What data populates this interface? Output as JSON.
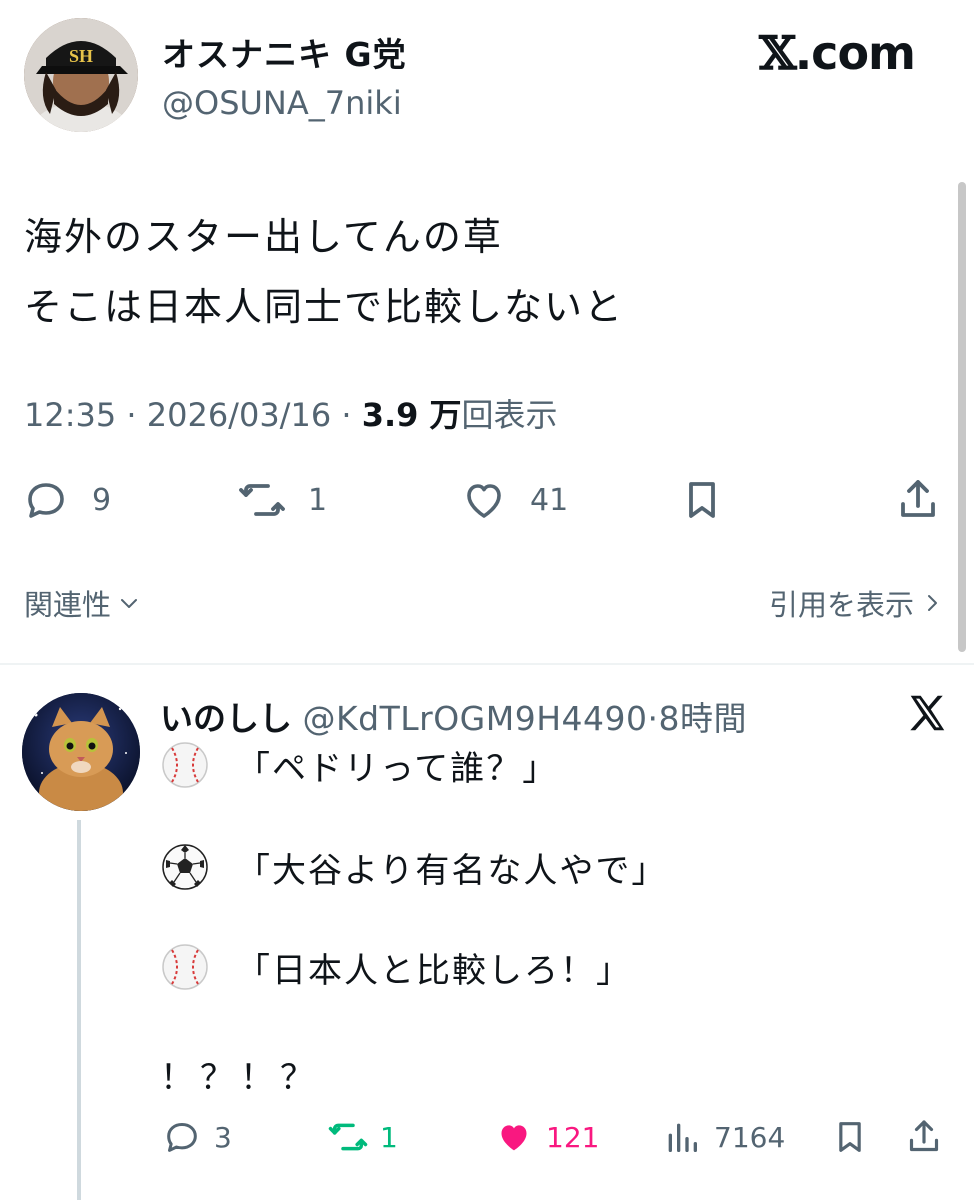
{
  "main_tweet": {
    "display_name": "オスナニキ G党",
    "handle": "@OSUNA_7niki",
    "site_label": ".com",
    "lines": [
      "海外のスター出してんの草",
      "そこは日本人同士で比較しないと"
    ],
    "time": "12:35",
    "date": "2026/03/16",
    "views_number": "3.9",
    "views_unit": "万",
    "views_label": "回表示",
    "replies": "9",
    "reposts": "1",
    "likes": "41",
    "related_label": "関連性",
    "quotes_label": "引用を表示"
  },
  "reply": {
    "display_name": "いのしし",
    "handle": "@KdTLrOGM9H4490",
    "time": "8時間",
    "lines": [
      {
        "emoji": "baseball-icon",
        "text": "「ペドリって誰？」"
      },
      {
        "emoji": "soccer-ball-icon",
        "text": "「大谷より有名な人やで」"
      },
      {
        "emoji": "baseball-icon",
        "text": "「日本人と比較しろ！」"
      }
    ],
    "exclaim": "！？！？",
    "replies": "3",
    "reposts": "1",
    "likes": "121",
    "views": "7164"
  },
  "colors": {
    "text": "#0f1419",
    "secondary": "#536471",
    "repost_active": "#00ba7c",
    "like_active": "#f91880",
    "divider": "#eff3f4"
  }
}
